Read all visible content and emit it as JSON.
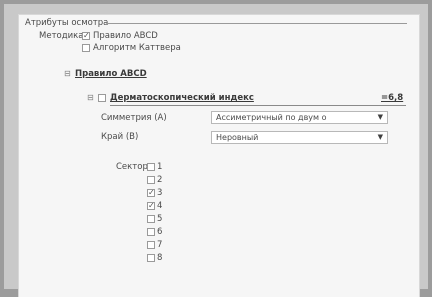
{
  "section_title": "Атрибуты осмотра",
  "method_label": "Методика",
  "methods": [
    {
      "label": "Правило ABCD",
      "checked": true
    },
    {
      "label": "Алгоритм Каттвера",
      "checked": false
    }
  ],
  "tree": {
    "node_label": "Правило ABCD",
    "sub_node_label": "Дерматоскопический индекс",
    "index_value": "=6,8"
  },
  "fields": {
    "symmetry": {
      "label": "Симметрия (А)",
      "value": "Ассиметричный по двум о"
    },
    "edge": {
      "label": "Край (В)",
      "value": "Неровный"
    }
  },
  "sector": {
    "label": "Сектор",
    "items": [
      {
        "label": "1",
        "checked": false
      },
      {
        "label": "2",
        "checked": false
      },
      {
        "label": "3",
        "checked": true
      },
      {
        "label": "4",
        "checked": true
      },
      {
        "label": "5",
        "checked": false
      },
      {
        "label": "6",
        "checked": false
      },
      {
        "label": "7",
        "checked": false
      },
      {
        "label": "8",
        "checked": false
      }
    ]
  }
}
